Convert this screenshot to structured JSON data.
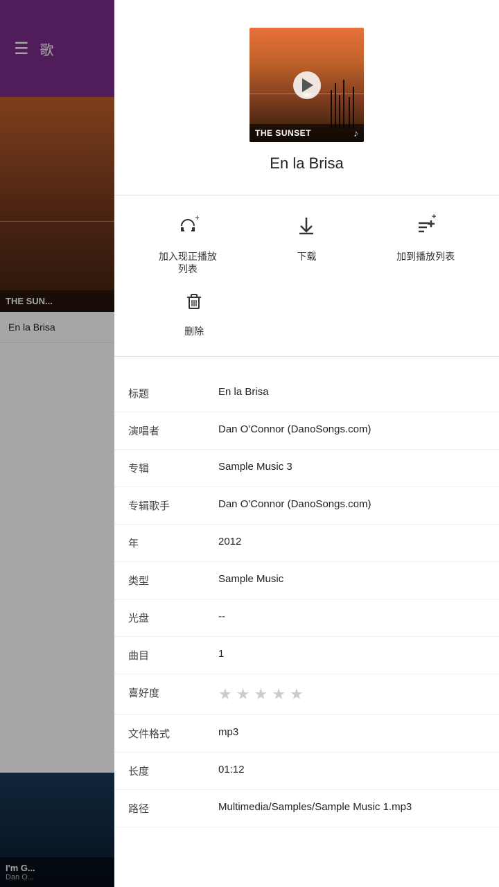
{
  "sidebar": {
    "menu_icon": "☰",
    "title": "歌",
    "album_title": "THE SUN...",
    "song_label": "En la Brisa",
    "bottom_label": "I'm G...",
    "bottom_artist": "Dan O..."
  },
  "album": {
    "title": "THE SUNSET",
    "music_note": "♪"
  },
  "song": {
    "title": "En la Brisa"
  },
  "actions": {
    "add_to_queue_label": "加入现正播放\n列表",
    "add_to_queue_label_line1": "加入现正播放",
    "add_to_queue_label_line2": "列表",
    "download_label": "下载",
    "add_to_playlist_label": "加到播放列表",
    "delete_label": "删除"
  },
  "metadata": [
    {
      "key": "标题",
      "value": "En la Brisa"
    },
    {
      "key": "演唱者",
      "value": "Dan O'Connor (DanoSongs.com)"
    },
    {
      "key": "专辑",
      "value": "Sample Music 3"
    },
    {
      "key": "专辑歌手",
      "value": "Dan O'Connor (DanoSongs.com)"
    },
    {
      "key": "年",
      "value": "2012"
    },
    {
      "key": "类型",
      "value": "Sample Music"
    },
    {
      "key": "光盘",
      "value": "--"
    },
    {
      "key": "曲目",
      "value": "1"
    },
    {
      "key": "喜好度",
      "value": "stars"
    },
    {
      "key": "文件格式",
      "value": "mp3"
    },
    {
      "key": "长度",
      "value": "01:12"
    },
    {
      "key": "路径",
      "value": "Multimedia/Samples/Sample Music 1.mp3"
    }
  ],
  "colors": {
    "purple": "#7b2d8b",
    "text_dark": "#222222",
    "text_mid": "#444444"
  }
}
